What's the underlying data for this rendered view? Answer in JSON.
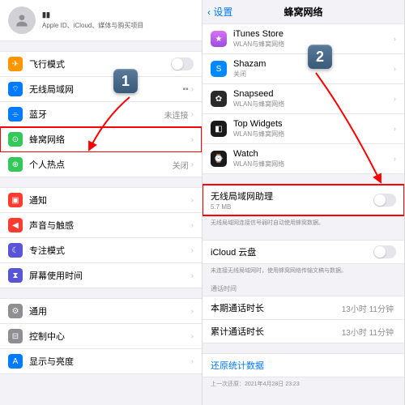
{
  "left": {
    "profile_name": "▮▮",
    "profile_sub": "Apple ID、iCloud、媒体与购买项目",
    "rows": {
      "airplane": "飞行模式",
      "wifi": "无线局域网",
      "bt": "蓝牙",
      "bt_detail": "未连接",
      "cellular": "蜂窝网络",
      "hotspot": "个人热点",
      "hotspot_detail": "关闭",
      "notif": "通知",
      "sound": "声音与触感",
      "focus": "专注模式",
      "screen": "屏幕使用时间",
      "general": "通用",
      "control": "控制中心",
      "display": "显示与亮度"
    }
  },
  "right": {
    "back": "设置",
    "title": "蜂窝网络",
    "apps": {
      "itunes": {
        "name": "iTunes Store",
        "sub": "WLAN与蜂窝网络"
      },
      "shazam": {
        "name": "Shazam",
        "sub": "关闭"
      },
      "snapseed": {
        "name": "Snapseed",
        "sub": "WLAN与蜂窝网络"
      },
      "topw": {
        "name": "Top Widgets",
        "sub": "WLAN与蜂窝网络"
      },
      "watch": {
        "name": "Watch",
        "sub": "WLAN与蜂窝网络"
      }
    },
    "wlan_assist": "无线局域网助理",
    "wlan_assist_sub": "5.7 MB",
    "wlan_assist_note": "无线局域网连接信号弱时自动使用蜂窝数据。",
    "icloud": "iCloud 云盘",
    "icloud_note": "未连接无线局域网时，使用蜂窝网络传输文稿与数据。",
    "call_section": "通话时间",
    "cur_call": "本期通话时长",
    "cur_call_val": "13小时 11分钟",
    "total_call": "累计通话时长",
    "total_call_val": "13小时 11分钟",
    "reset": "还原统计数据",
    "reset_sub": "上一次还原：2021年4月28日 23:23"
  },
  "badges": {
    "one": "1",
    "two": "2"
  }
}
